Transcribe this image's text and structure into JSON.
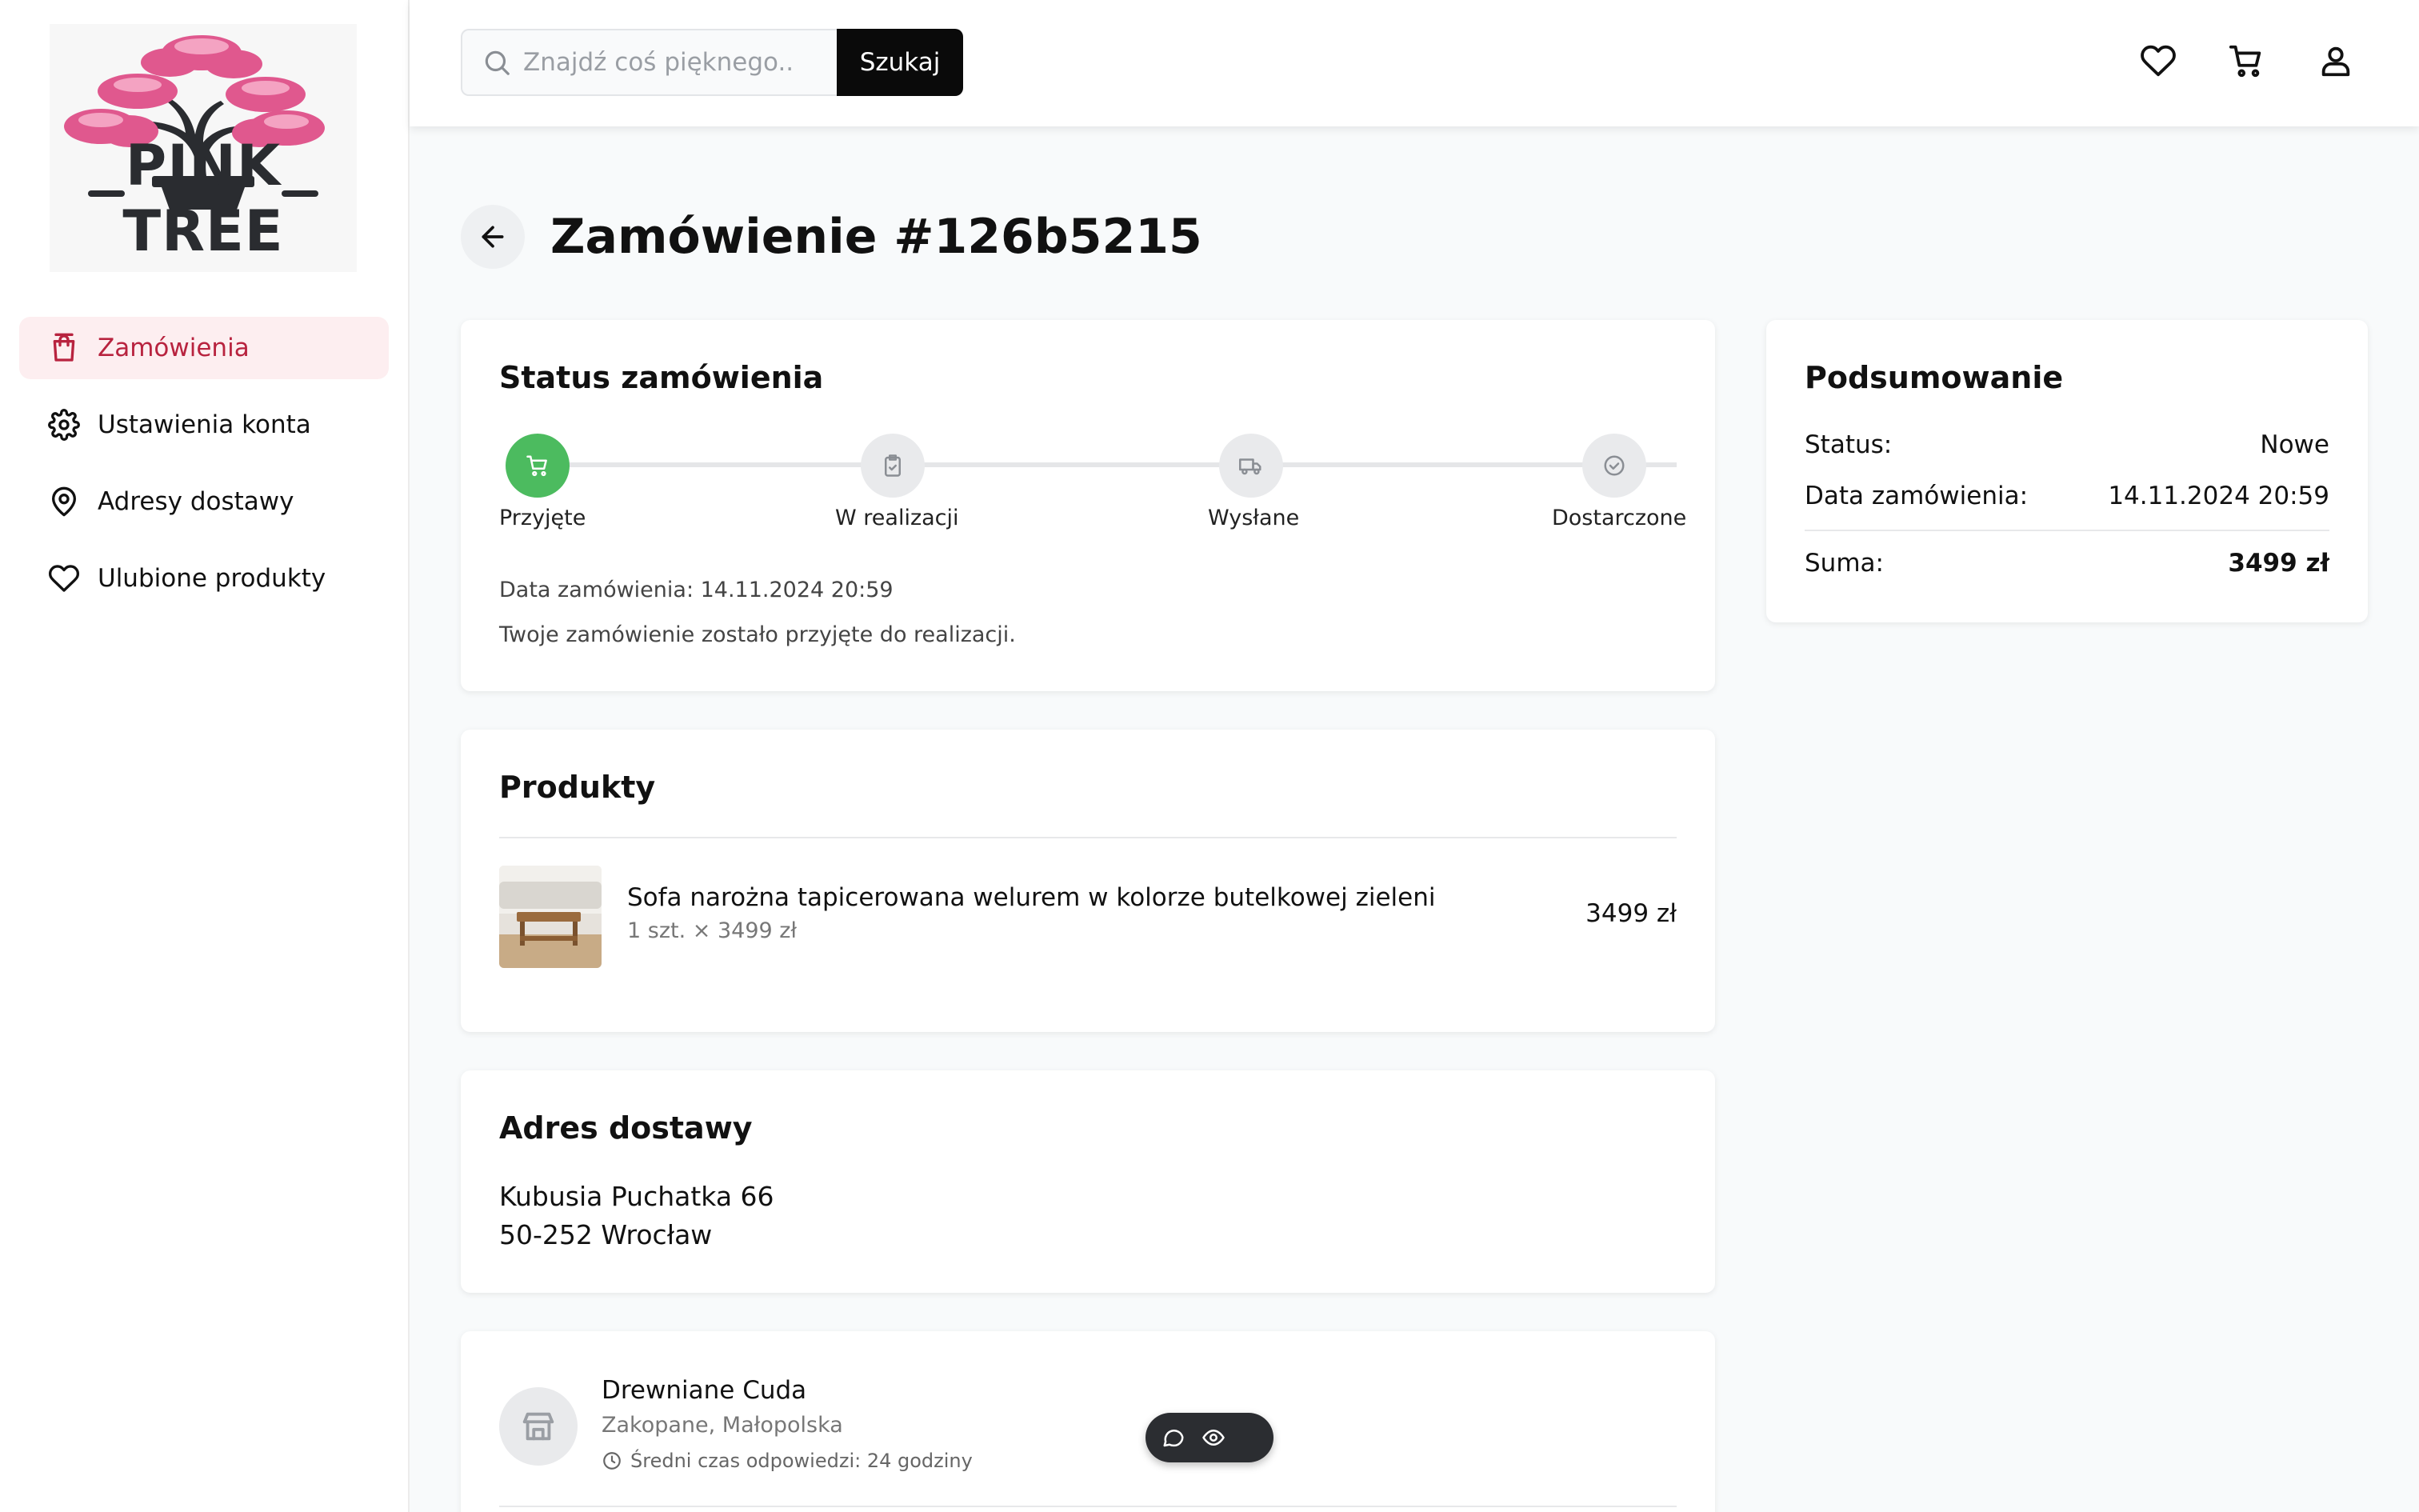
{
  "brand": {
    "name": "PINK TREE"
  },
  "sidebar": {
    "items": [
      {
        "label": "Zamówienia",
        "icon": "shopping-bag-icon",
        "active": true
      },
      {
        "label": "Ustawienia konta",
        "icon": "gear-icon",
        "active": false
      },
      {
        "label": "Adresy dostawy",
        "icon": "map-pin-icon",
        "active": false
      },
      {
        "label": "Ulubione produkty",
        "icon": "heart-icon",
        "active": false
      }
    ]
  },
  "header": {
    "search": {
      "placeholder": "Znajdź coś pięknego...",
      "value": "",
      "button_label": "Szukaj"
    },
    "icons": [
      "heart-icon",
      "cart-icon",
      "user-icon"
    ]
  },
  "page": {
    "title": "Zamówienie #126b5215"
  },
  "status_card": {
    "title": "Status zamówienia",
    "steps": [
      {
        "label": "Przyjęte",
        "icon": "cart-icon",
        "done": true
      },
      {
        "label": "W realizacji",
        "icon": "clipboard-check-icon",
        "done": false
      },
      {
        "label": "Wysłane",
        "icon": "truck-icon",
        "done": false
      },
      {
        "label": "Dostarczone",
        "icon": "check-circle-icon",
        "done": false
      }
    ],
    "order_date_text": "Data zamówienia: 14.11.2024 20:59",
    "message": "Twoje zamówienie zostało przyjęte do realizacji."
  },
  "products_card": {
    "title": "Produkty",
    "items": [
      {
        "name": "Sofa narożna tapicerowana welurem w kolorze butelkowej zieleni",
        "qty_text": "1 szt. × 3499 zł",
        "price": "3499 zł"
      }
    ]
  },
  "address_card": {
    "title": "Adres dostawy",
    "line1": "Kubusia Puchatka 66",
    "line2": "50-252 Wrocław"
  },
  "seller_card": {
    "name": "Drewniane Cuda",
    "location": "Zakopane, Małopolska",
    "response_time": "Średni czas odpowiedzi: 24 godziny"
  },
  "summary_card": {
    "title": "Podsumowanie",
    "status_label": "Status:",
    "status_value": "Nowe",
    "date_label": "Data zamówienia:",
    "date_value": "14.11.2024 20:59",
    "total_label": "Suma:",
    "total_value": "3499 zł"
  },
  "colors": {
    "accent": "#b8233f",
    "accent_bg": "#fdeef0",
    "step_done": "#4cbb5f",
    "brand_pink": "#e0588e"
  }
}
